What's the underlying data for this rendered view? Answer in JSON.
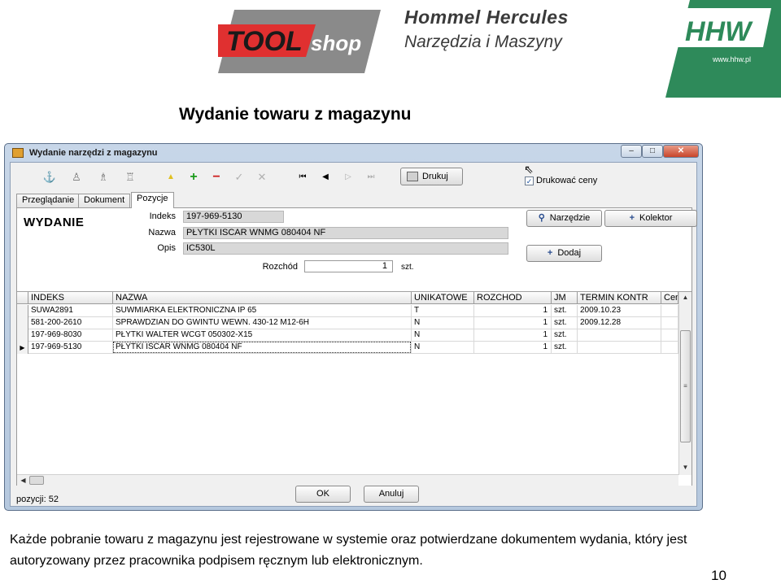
{
  "header": {
    "tool_logo": {
      "part1": "TOOL",
      "part2": "shop"
    },
    "brand_title": "Hommel Hercules",
    "brand_subtitle": "Narzędzia i Maszyny",
    "hhw_logo": {
      "mark": "HHW",
      "url_text": "www.hhw.pl"
    }
  },
  "slide_title": "Wydanie towaru z magazynu",
  "window": {
    "title": "Wydanie narzędzi z magazynu",
    "controls": [
      "–",
      "□",
      "✕"
    ],
    "toolbar": {
      "print_label": "Drukuj",
      "print_prices_label": "Drukować ceny",
      "print_prices_checked": true
    },
    "tabs": [
      {
        "label": "Przeglądanie",
        "active": false
      },
      {
        "label": "Dokument",
        "active": false
      },
      {
        "label": "Pozycje",
        "active": true
      }
    ],
    "form": {
      "heading": "WYDANIE",
      "index_label": "Indeks",
      "index_value": "197-969-5130",
      "name_label": "Nazwa",
      "name_value": "PŁYTKI ISCAR WNMG 080404 NF",
      "desc_label": "Opis",
      "desc_value": "IC530L",
      "issue_label": "Rozchód",
      "issue_value": "1",
      "issue_unit": "szt.",
      "btn_tool": "Narzędzie",
      "btn_collector": "Kolektor",
      "btn_add": "Dodaj"
    },
    "grid": {
      "columns": [
        "INDEKS",
        "NAZWA",
        "UNIKATOWE",
        "ROZCHOD",
        "JM",
        "TERMIN KONTR",
        "Cen"
      ],
      "rows": [
        {
          "indeks": "SUWA2891",
          "nazwa": "SUWMIARKA ELEKTRONICZNA IP 65",
          "unikatowe": "T",
          "rozchod": "1",
          "jm": "szt.",
          "termin": "2009.10.23",
          "cena": ""
        },
        {
          "indeks": "581-200-2610",
          "nazwa": "SPRAWDZIAN DO GWINTU WEWN. 430-12 M12-6H",
          "unikatowe": "N",
          "rozchod": "1",
          "jm": "szt.",
          "termin": "2009.12.28",
          "cena": ""
        },
        {
          "indeks": "197-969-8030",
          "nazwa": "PŁYTKI WALTER WCGT 050302-X15",
          "unikatowe": "N",
          "rozchod": "1",
          "jm": "szt.",
          "termin": "",
          "cena": ""
        },
        {
          "indeks": "197-969-5130",
          "nazwa": "PŁYTKI ISCAR WNMG 080404 NF",
          "unikatowe": "N",
          "rozchod": "1",
          "jm": "szt.",
          "termin": "",
          "cena": ""
        }
      ],
      "selected_row": 3
    },
    "ok_label": "OK",
    "cancel_label": "Anuluj",
    "status_label": "pozycji:",
    "status_count": "52"
  },
  "description": "Każde pobranie towaru z magazynu jest rejestrowane w systemie oraz potwierdzane dokumentem wydania, który jest autoryzowany przez pracownika podpisem ręcznym lub elektronicznym.",
  "page_number": "10",
  "colors": {
    "tool_red": "#e03030",
    "tool_gray": "#8a8a8a",
    "hhw_green": "#2e8a5a",
    "window_frame": "#b5c8de"
  }
}
